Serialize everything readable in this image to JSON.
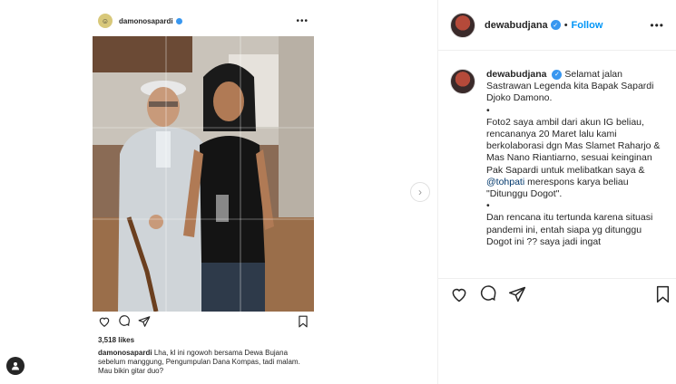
{
  "embedded_post": {
    "username": "damonosapardi",
    "likes": "3,518 likes",
    "caption_user": "damonosapardi",
    "caption_text": "Lha, kl ini ngowoh bersama Dewa Bujana sebelum manggung, Pengumpulan Dana Kompas, tadi malam. Mau bikin gitar duo?"
  },
  "post_header": {
    "username": "dewabudjana",
    "follow_label": "Follow",
    "separator": "•"
  },
  "comment": {
    "username": "dewabudjana",
    "lines": [
      "Selamat jalan Sastrawan Legenda kita Bapak Sapardi Djoko Damono.",
      "•",
      "Foto2 saya ambil dari akun IG beliau, rencananya 20 Maret lalu kami berkolaborasi dgn Mas Slamet Raharjo & Mas Nano Riantiarno, sesuai keinginan Pak Sapardi untuk melibatkan saya & ",
      "•",
      "Dan rencana itu tertunda karena situasi pandemi ini, entah siapa yg ditunggu Dogot ini ?? saya jadi ingat"
    ],
    "mention": "@tohpati",
    "after_mention": " merespons karya beliau \"Ditunggu Dogot\"."
  },
  "icons": {
    "like": "heart-icon",
    "comment": "comment-icon",
    "share": "share-icon",
    "save": "bookmark-icon",
    "more": "more-icon",
    "next": "chevron-right-icon"
  },
  "colors": {
    "accent": "#0095f6",
    "verified": "#3897f0",
    "text": "#262626",
    "border": "#efefef"
  }
}
